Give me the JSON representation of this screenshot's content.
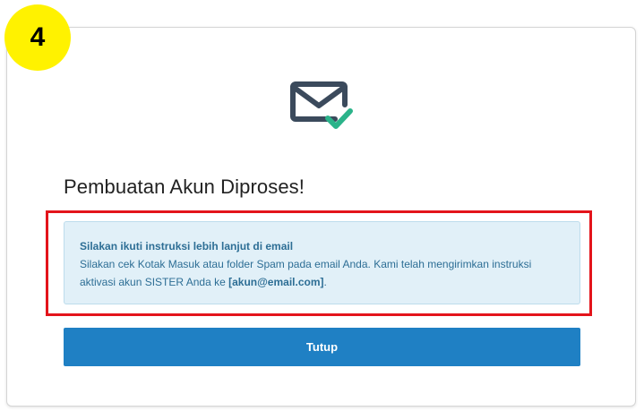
{
  "step_badge": "4",
  "dialog": {
    "title": "Pembuatan Akun Diproses!",
    "icon": "mail-check-icon",
    "alert": {
      "heading": "Silakan ikuti instruksi lebih lanjut di email",
      "body_text": "Silakan cek Kotak Masuk atau folder Spam pada email Anda. Kami telah mengirimkan instruksi aktivasi akun SISTER Anda ke ",
      "email": "[akun@email.com]",
      "body_end": "."
    },
    "close_label": "Tutup"
  },
  "colors": {
    "badge": "#fff200",
    "highlight_border": "#e3141b",
    "alert_background": "#e1f0f8",
    "alert_text": "#2d6e95",
    "button": "#1f80c4",
    "icon_envelope": "#3b4a5c",
    "icon_check": "#2bb38a"
  }
}
